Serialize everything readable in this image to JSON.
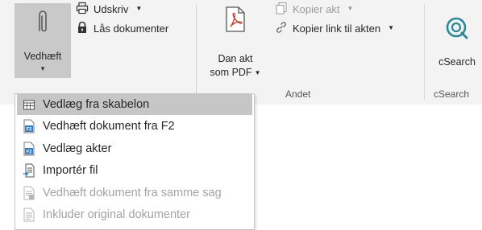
{
  "ribbon": {
    "vedhaeft_label": "Vedhæft",
    "vedhaeft_caret": "▾",
    "udskriv_label": "Udskriv",
    "laas_label": "Lås dokumenter",
    "dan_akt_line1": "Dan akt",
    "dan_akt_line2": "som PDF",
    "kopier_akt_label": "Kopier akt",
    "kopier_link_label": "Kopier link til akten",
    "andet_group": "Andet",
    "csearch_label": "cSearch",
    "csearch_group": "cSearch"
  },
  "menu": {
    "items": [
      {
        "label": "Vedlæg fra skabelon",
        "icon": "template-icon",
        "state": "highlighted"
      },
      {
        "label": "Vedhæft dokument fra F2",
        "icon": "f2-document-icon",
        "state": "enabled"
      },
      {
        "label": "Vedlæg akter",
        "icon": "f2-document-icon",
        "state": "enabled"
      },
      {
        "label": "Importér fil",
        "icon": "import-file-icon",
        "state": "enabled"
      },
      {
        "label": "Vedhæft dokument fra samme sag",
        "icon": "same-case-document-icon",
        "state": "disabled"
      },
      {
        "label": "Inkluder original dokumenter",
        "icon": "original-document-icon",
        "state": "disabled"
      }
    ]
  },
  "colors": {
    "ribbon_bg": "#f3f3f3",
    "pressed_bg": "#c9c9c9",
    "highlight_bg": "#c6c6c6",
    "f2_blue": "#2e7cc9",
    "csearch_teal": "#2a8a9a",
    "pdf_red": "#c0392b"
  }
}
